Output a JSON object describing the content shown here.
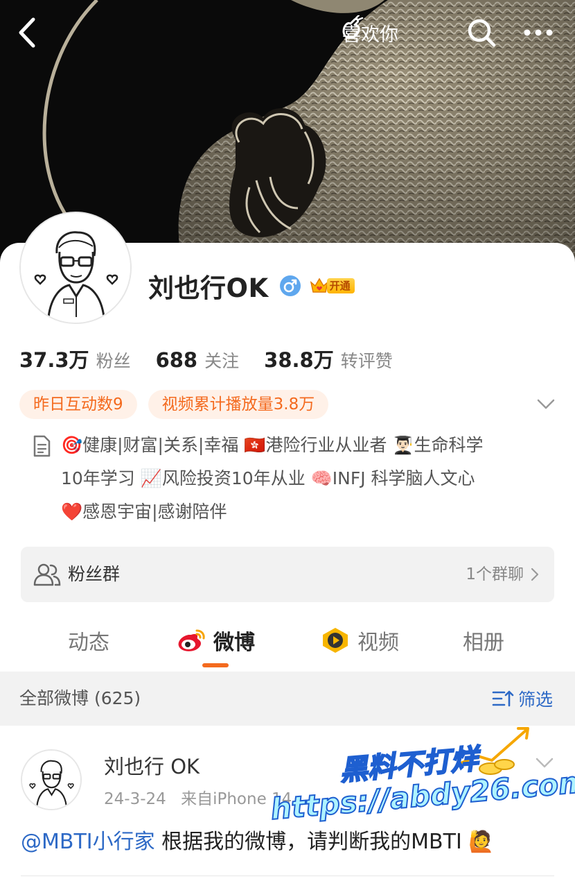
{
  "topbar": {
    "like_label": "喜欢你"
  },
  "profile": {
    "name": "刘也行OK",
    "vip_label": "开通",
    "stats": [
      {
        "value": "37.3万",
        "label": "粉丝"
      },
      {
        "value": "688",
        "label": "关注"
      },
      {
        "value": "38.8万",
        "label": "转评赞"
      }
    ],
    "tags": [
      "昨日互动数9",
      "视频累计播放量3.8万"
    ],
    "bio_lines": [
      "🎯健康|财富|关系|幸福 🇭🇰港险行业从业者 👨🏻‍🎓生命科学",
      "10年学习 📈风险投资10年从业 🧠INFJ 科学脑人文心",
      "❤️感恩宇宙|感谢陪伴"
    ]
  },
  "fans_group": {
    "label": "粉丝群",
    "count": "1个群聊"
  },
  "tabs": [
    {
      "label": "动态"
    },
    {
      "label": "微博"
    },
    {
      "label": "视频"
    },
    {
      "label": "相册"
    }
  ],
  "section": {
    "title": "全部微博 (625)",
    "filter_label": "筛选"
  },
  "post": {
    "author": "刘也行 OK",
    "date": "24-3-24",
    "source": "来自iPhone 14",
    "mention": "@MBTI小行家",
    "text": " 根据我的微博，请判断我的MBTI 🙋"
  },
  "watermark": {
    "line1": "黑料不打烊",
    "line2": "https://abdy26.com"
  },
  "colors": {
    "accent": "#f46a1e",
    "link": "#2d69c6",
    "tag_bg": "#fff1e8"
  }
}
